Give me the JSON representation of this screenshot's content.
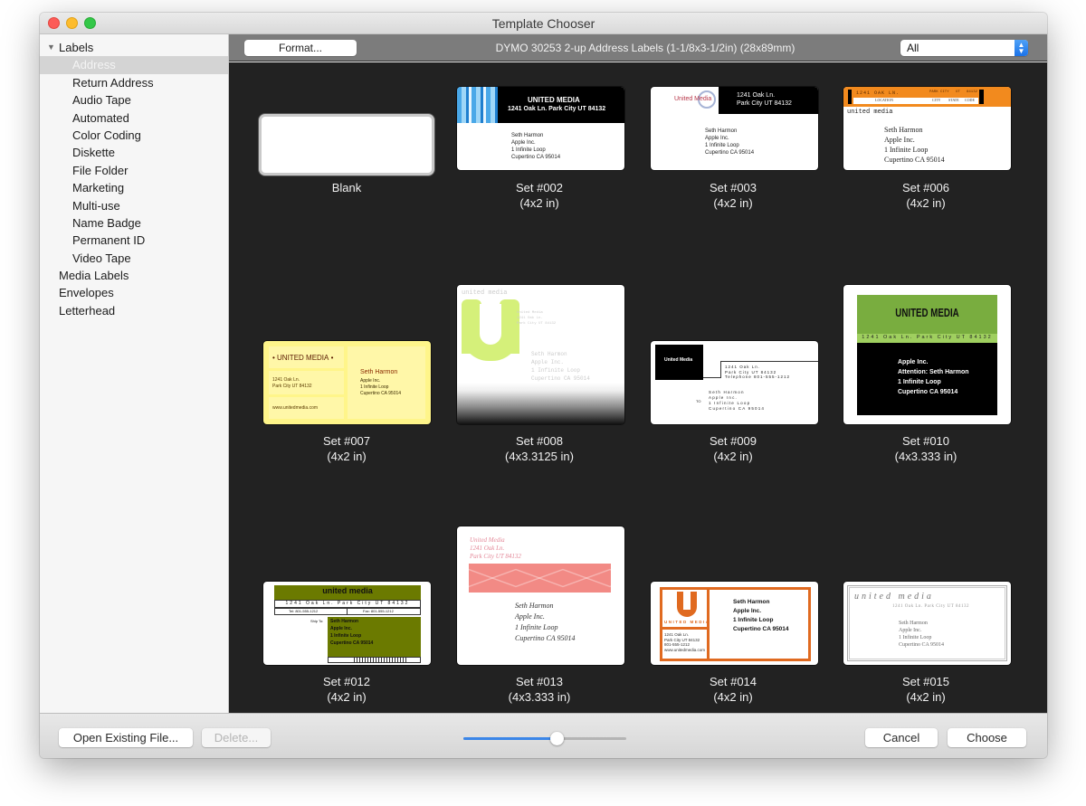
{
  "window": {
    "title": "Template Chooser"
  },
  "sidebar": {
    "groups": [
      {
        "label": "Labels",
        "expanded": true,
        "items": [
          {
            "label": "Address",
            "selected": true
          },
          {
            "label": "Return Address"
          },
          {
            "label": "Audio Tape"
          },
          {
            "label": "Automated"
          },
          {
            "label": "Color Coding"
          },
          {
            "label": "Diskette"
          },
          {
            "label": "File Folder"
          },
          {
            "label": "Marketing"
          },
          {
            "label": "Multi-use"
          },
          {
            "label": "Name Badge"
          },
          {
            "label": "Permanent ID"
          },
          {
            "label": "Video Tape"
          }
        ]
      }
    ],
    "top_items": [
      "Media Labels",
      "Envelopes",
      "Letterhead"
    ]
  },
  "toolbar": {
    "format_label": "Format...",
    "label_title": "DYMO 30253 2-up Address Labels (1-1/8x3-1/2in) (28x89mm)",
    "filter_value": "All",
    "stepper_icon": "up-down-chevron-icon"
  },
  "templates": [
    {
      "name": "Blank",
      "size": "",
      "selected": true
    },
    {
      "name": "Set #002",
      "size": "(4x2 in)"
    },
    {
      "name": "Set #003",
      "size": "(4x2 in)"
    },
    {
      "name": "Set #006",
      "size": "(4x2 in)"
    },
    {
      "name": "Set #007",
      "size": "(4x2 in)"
    },
    {
      "name": "Set #008",
      "size": "(4x3.3125 in)"
    },
    {
      "name": "Set #009",
      "size": "(4x2 in)"
    },
    {
      "name": "Set #010",
      "size": "(4x3.333 in)"
    },
    {
      "name": "Set #012",
      "size": "(4x2 in)"
    },
    {
      "name": "Set #013",
      "size": "(4x3.333 in)"
    },
    {
      "name": "Set #014",
      "size": "(4x2 in)"
    },
    {
      "name": "Set #015",
      "size": "(4x2 in)"
    }
  ],
  "sample": {
    "company_upper": "UNITED MEDIA",
    "company_lower": "united media",
    "company_title": "United Media",
    "street": "1241 Oak Ln.",
    "city_line": "Park City UT 84132",
    "full_address": "1241 Oak Ln. Park City UT 84132",
    "telephone": "Telephone 801-555-1212",
    "tel": "Tel: 801-555-1212",
    "fax": "Fax: 801-555-1212",
    "phone": "801-555-1212",
    "website": "www.unitedmedia.com",
    "recipient": "Seth Harmon",
    "org": "Apple Inc.",
    "attention": "Attention: Seth Harmon",
    "addr1": "1 Infinite Loop",
    "addr2": "Cupertino CA 95014",
    "ship_to": "Ship To:",
    "to": "TO",
    "loc_labels": [
      "LOCATION",
      "CITY",
      "STATE",
      "CODE"
    ],
    "loc_values": [
      "1241 OAK LN.",
      "PARK CITY",
      "UT",
      "84132"
    ]
  },
  "footer": {
    "open_label": "Open Existing File...",
    "delete_label": "Delete...",
    "cancel_label": "Cancel",
    "choose_label": "Choose",
    "zoom_slider_value": 0.57
  },
  "colors": {
    "accent": "#3b86e8",
    "grid_bg": "#222222",
    "orange": "#f28a1e",
    "green": "#79ad3f",
    "olive": "#6b7a00",
    "salmon": "#f28a85",
    "lime": "#d5f07a",
    "yellow": "#fff58a",
    "rust": "#e06a20"
  }
}
